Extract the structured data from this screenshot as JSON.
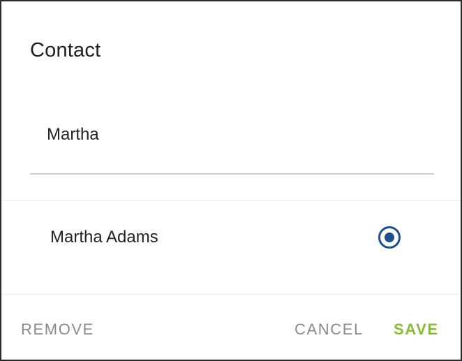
{
  "dialog": {
    "title": "Contact"
  },
  "search": {
    "value": "Martha"
  },
  "results": {
    "items": [
      {
        "label": "Martha Adams",
        "selected": true
      }
    ]
  },
  "actions": {
    "remove_label": "REMOVE",
    "cancel_label": "CANCEL",
    "save_label": "SAVE"
  },
  "colors": {
    "accent_primary": "#1f4e8c",
    "save_green": "#86bf2f",
    "muted_text": "#8a8a8a"
  },
  "icons": {
    "selection": "radio-selected-icon"
  }
}
